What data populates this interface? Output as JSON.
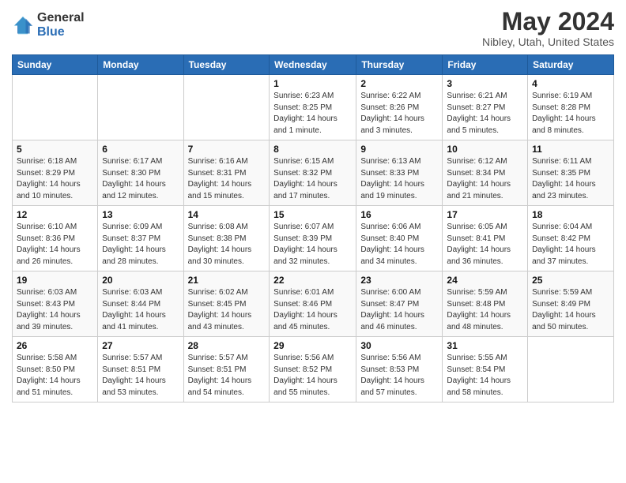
{
  "logo": {
    "general": "General",
    "blue": "Blue"
  },
  "header": {
    "title": "May 2024",
    "subtitle": "Nibley, Utah, United States"
  },
  "weekdays": [
    "Sunday",
    "Monday",
    "Tuesday",
    "Wednesday",
    "Thursday",
    "Friday",
    "Saturday"
  ],
  "weeks": [
    [
      {
        "day": "",
        "info": ""
      },
      {
        "day": "",
        "info": ""
      },
      {
        "day": "",
        "info": ""
      },
      {
        "day": "1",
        "info": "Sunrise: 6:23 AM\nSunset: 8:25 PM\nDaylight: 14 hours\nand 1 minute."
      },
      {
        "day": "2",
        "info": "Sunrise: 6:22 AM\nSunset: 8:26 PM\nDaylight: 14 hours\nand 3 minutes."
      },
      {
        "day": "3",
        "info": "Sunrise: 6:21 AM\nSunset: 8:27 PM\nDaylight: 14 hours\nand 5 minutes."
      },
      {
        "day": "4",
        "info": "Sunrise: 6:19 AM\nSunset: 8:28 PM\nDaylight: 14 hours\nand 8 minutes."
      }
    ],
    [
      {
        "day": "5",
        "info": "Sunrise: 6:18 AM\nSunset: 8:29 PM\nDaylight: 14 hours\nand 10 minutes."
      },
      {
        "day": "6",
        "info": "Sunrise: 6:17 AM\nSunset: 8:30 PM\nDaylight: 14 hours\nand 12 minutes."
      },
      {
        "day": "7",
        "info": "Sunrise: 6:16 AM\nSunset: 8:31 PM\nDaylight: 14 hours\nand 15 minutes."
      },
      {
        "day": "8",
        "info": "Sunrise: 6:15 AM\nSunset: 8:32 PM\nDaylight: 14 hours\nand 17 minutes."
      },
      {
        "day": "9",
        "info": "Sunrise: 6:13 AM\nSunset: 8:33 PM\nDaylight: 14 hours\nand 19 minutes."
      },
      {
        "day": "10",
        "info": "Sunrise: 6:12 AM\nSunset: 8:34 PM\nDaylight: 14 hours\nand 21 minutes."
      },
      {
        "day": "11",
        "info": "Sunrise: 6:11 AM\nSunset: 8:35 PM\nDaylight: 14 hours\nand 23 minutes."
      }
    ],
    [
      {
        "day": "12",
        "info": "Sunrise: 6:10 AM\nSunset: 8:36 PM\nDaylight: 14 hours\nand 26 minutes."
      },
      {
        "day": "13",
        "info": "Sunrise: 6:09 AM\nSunset: 8:37 PM\nDaylight: 14 hours\nand 28 minutes."
      },
      {
        "day": "14",
        "info": "Sunrise: 6:08 AM\nSunset: 8:38 PM\nDaylight: 14 hours\nand 30 minutes."
      },
      {
        "day": "15",
        "info": "Sunrise: 6:07 AM\nSunset: 8:39 PM\nDaylight: 14 hours\nand 32 minutes."
      },
      {
        "day": "16",
        "info": "Sunrise: 6:06 AM\nSunset: 8:40 PM\nDaylight: 14 hours\nand 34 minutes."
      },
      {
        "day": "17",
        "info": "Sunrise: 6:05 AM\nSunset: 8:41 PM\nDaylight: 14 hours\nand 36 minutes."
      },
      {
        "day": "18",
        "info": "Sunrise: 6:04 AM\nSunset: 8:42 PM\nDaylight: 14 hours\nand 37 minutes."
      }
    ],
    [
      {
        "day": "19",
        "info": "Sunrise: 6:03 AM\nSunset: 8:43 PM\nDaylight: 14 hours\nand 39 minutes."
      },
      {
        "day": "20",
        "info": "Sunrise: 6:03 AM\nSunset: 8:44 PM\nDaylight: 14 hours\nand 41 minutes."
      },
      {
        "day": "21",
        "info": "Sunrise: 6:02 AM\nSunset: 8:45 PM\nDaylight: 14 hours\nand 43 minutes."
      },
      {
        "day": "22",
        "info": "Sunrise: 6:01 AM\nSunset: 8:46 PM\nDaylight: 14 hours\nand 45 minutes."
      },
      {
        "day": "23",
        "info": "Sunrise: 6:00 AM\nSunset: 8:47 PM\nDaylight: 14 hours\nand 46 minutes."
      },
      {
        "day": "24",
        "info": "Sunrise: 5:59 AM\nSunset: 8:48 PM\nDaylight: 14 hours\nand 48 minutes."
      },
      {
        "day": "25",
        "info": "Sunrise: 5:59 AM\nSunset: 8:49 PM\nDaylight: 14 hours\nand 50 minutes."
      }
    ],
    [
      {
        "day": "26",
        "info": "Sunrise: 5:58 AM\nSunset: 8:50 PM\nDaylight: 14 hours\nand 51 minutes."
      },
      {
        "day": "27",
        "info": "Sunrise: 5:57 AM\nSunset: 8:51 PM\nDaylight: 14 hours\nand 53 minutes."
      },
      {
        "day": "28",
        "info": "Sunrise: 5:57 AM\nSunset: 8:51 PM\nDaylight: 14 hours\nand 54 minutes."
      },
      {
        "day": "29",
        "info": "Sunrise: 5:56 AM\nSunset: 8:52 PM\nDaylight: 14 hours\nand 55 minutes."
      },
      {
        "day": "30",
        "info": "Sunrise: 5:56 AM\nSunset: 8:53 PM\nDaylight: 14 hours\nand 57 minutes."
      },
      {
        "day": "31",
        "info": "Sunrise: 5:55 AM\nSunset: 8:54 PM\nDaylight: 14 hours\nand 58 minutes."
      },
      {
        "day": "",
        "info": ""
      }
    ]
  ]
}
